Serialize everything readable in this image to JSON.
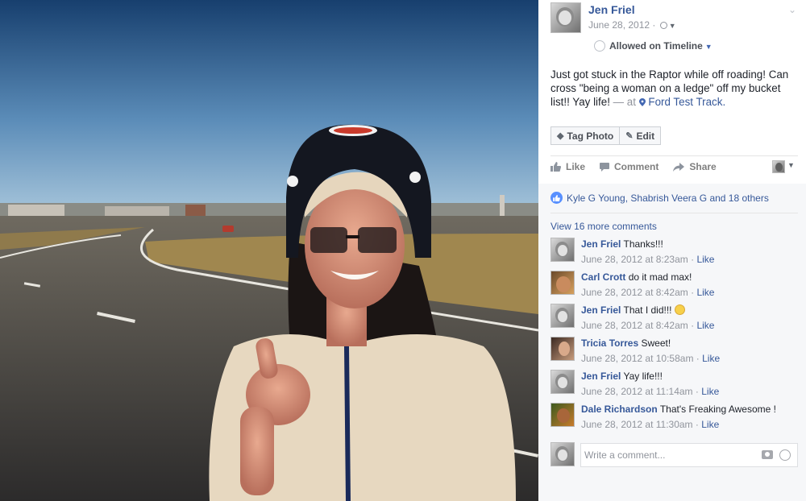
{
  "post": {
    "author": "Jen Friel",
    "date": "June 28, 2012 ·",
    "timeline_label": "Allowed on Timeline",
    "text": "Just got stuck in the Raptor while off roading! Can cross \"being a woman on a ledge\" off my bucket list!! Yay life!",
    "at_label": "— at",
    "place": "Ford Test Track."
  },
  "photo_actions": {
    "tag_photo": "Tag Photo",
    "edit": "Edit"
  },
  "ufi": {
    "like": "Like",
    "comment": "Comment",
    "share": "Share",
    "likes_summary": "Kyle G Young, Shabrish Veera G and 18 others",
    "view_more": "View 16 more comments"
  },
  "comments": [
    {
      "name": "Jen Friel",
      "text": "Thanks!!!",
      "time": "June 28, 2012 at 8:23am ·",
      "like": "Like"
    },
    {
      "name": "Carl Crott",
      "text": "do it mad max!",
      "time": "June 28, 2012 at 8:42am ·",
      "like": "Like"
    },
    {
      "name": "Jen Friel",
      "text": "That I did!!!",
      "time": "June 28, 2012 at 8:42am ·",
      "like": "Like"
    },
    {
      "name": "Tricia Torres",
      "text": "Sweet!",
      "time": "June 28, 2012 at 10:58am ·",
      "like": "Like"
    },
    {
      "name": "Jen Friel",
      "text": "Yay life!!!",
      "time": "June 28, 2012 at 11:14am ·",
      "like": "Like"
    },
    {
      "name": "Dale Richardson",
      "text": "That's Freaking Awesome !",
      "time": "June 28, 2012 at 11:30am ·",
      "like": "Like"
    }
  ],
  "composer": {
    "placeholder": "Write a comment..."
  },
  "icons": {
    "privacy": "globe-icon",
    "tag": "tag-icon",
    "edit": "pencil-icon",
    "like": "thumbs-up-icon",
    "comment": "comment-bubble-icon",
    "share": "share-arrow-icon",
    "camera": "camera-icon",
    "emoji": "emoji-icon"
  },
  "colors": {
    "link": "#365899",
    "meta": "#90949c",
    "like_blue": "#5890ff"
  }
}
